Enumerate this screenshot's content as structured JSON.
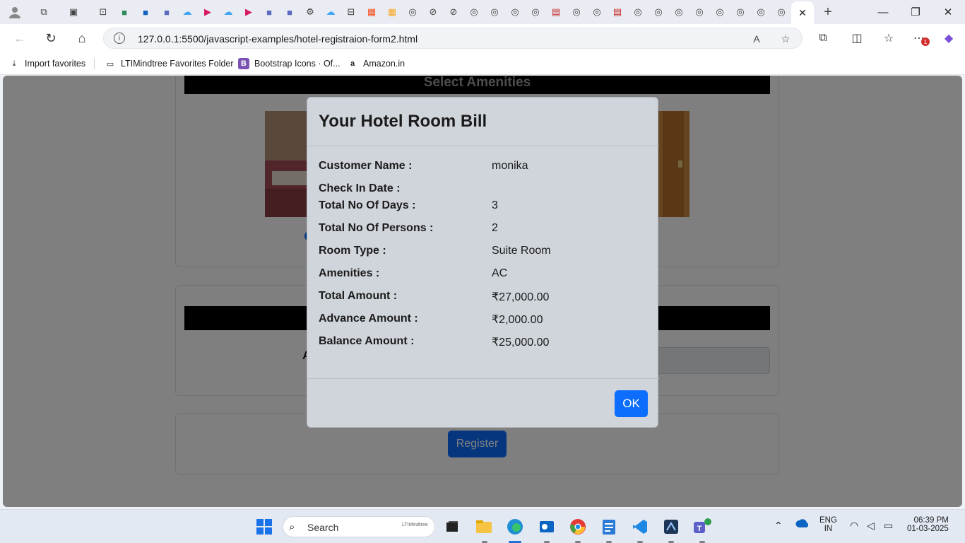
{
  "browser": {
    "url": "127.0.0.1:5500/javascript-examples/hotel-registraion-form2.html",
    "notification_count": "1",
    "favorites": [
      {
        "label": "Import favorites",
        "icon": "import-icon"
      },
      {
        "label": "LTIMindtree Favorites Folder",
        "icon": "folder-icon"
      },
      {
        "label": "Bootstrap Icons · Of...",
        "icon": "bootstrap-icon"
      },
      {
        "label": "Amazon.in",
        "icon": "amazon-icon"
      }
    ]
  },
  "page": {
    "amenities_heading": "Select Amenities",
    "register_label": "Register"
  },
  "modal": {
    "title": "Your Hotel Room Bill",
    "rows": [
      {
        "label": "Customer Name :",
        "value": "monika"
      },
      {
        "label": "Check In Date :",
        "value": ""
      },
      {
        "label": "Total No Of Days :",
        "value": "3"
      },
      {
        "label": "Total No Of Persons :",
        "value": "2"
      },
      {
        "label": "Room Type :",
        "value": "Suite Room"
      },
      {
        "label": "Amenities :",
        "value": "AC"
      },
      {
        "label": "Total Amount :",
        "value": "₹27,000.00"
      },
      {
        "label": "Advance Amount :",
        "value": "₹2,000.00"
      },
      {
        "label": "Balance Amount :",
        "value": "₹25,000.00"
      }
    ],
    "ok_label": "OK"
  },
  "taskbar": {
    "search_placeholder": "Search",
    "search_logo": "LTIMindtree",
    "lang": "ENG",
    "region": "IN",
    "time": "06:39 PM",
    "date": "01-03-2025"
  },
  "colors": {
    "primary": "#0d6efd",
    "modal_bg": "#d0d4db",
    "section_header": "#000000"
  }
}
